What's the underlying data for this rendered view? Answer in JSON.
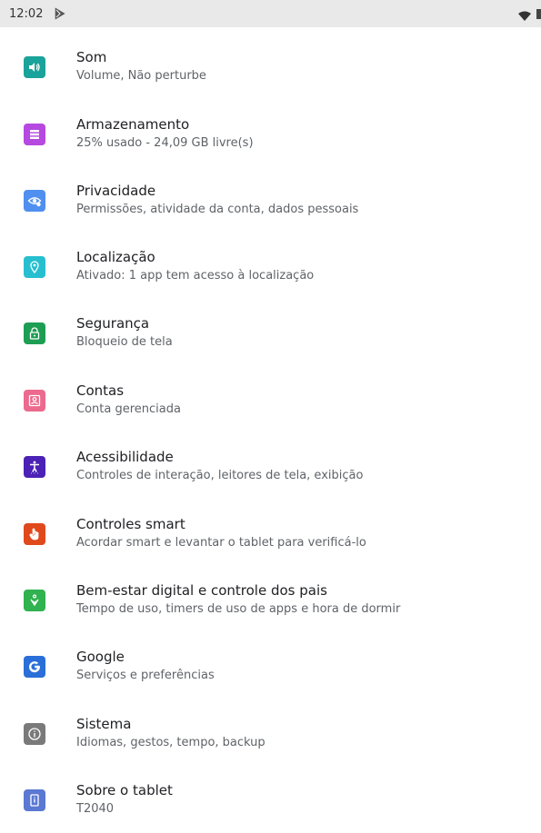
{
  "status_bar": {
    "time": "12:02",
    "notification_icon": "play-store-icon",
    "wifi_icon": "wifi-icon",
    "battery_icon": "battery-icon"
  },
  "settings": {
    "items": [
      {
        "title": "Som",
        "subtitle": "Volume, Não perturbe",
        "icon": "volume-icon",
        "color": "#1aa39a"
      },
      {
        "title": "Armazenamento",
        "subtitle": "25% usado - 24,09 GB livre(s)",
        "icon": "storage-icon",
        "color": "#b549e0"
      },
      {
        "title": "Privacidade",
        "subtitle": "Permissões, atividade da conta, dados pessoais",
        "icon": "privacy-eye-icon",
        "color": "#4f8ff0"
      },
      {
        "title": "Localização",
        "subtitle": "Ativado: 1 app tem acesso à localização",
        "icon": "location-pin-icon",
        "color": "#27bfcf"
      },
      {
        "title": "Segurança",
        "subtitle": "Bloqueio de tela",
        "icon": "lock-icon",
        "color": "#1e9e54"
      },
      {
        "title": "Contas",
        "subtitle": "Conta gerenciada",
        "icon": "account-box-icon",
        "color": "#ec6a8d"
      },
      {
        "title": "Acessibilidade",
        "subtitle": "Controles de interação, leitores de tela, exibição",
        "icon": "accessibility-icon",
        "color": "#4b22b5"
      },
      {
        "title": "Controles smart",
        "subtitle": "Acordar smart e levantar o tablet para verificá-lo",
        "icon": "hand-gesture-icon",
        "color": "#e0491c"
      },
      {
        "title": "Bem-estar digital e controle dos pais",
        "subtitle": "Tempo de uso, timers de uso de apps e hora de dormir",
        "icon": "wellbeing-icon",
        "color": "#2fb24f"
      },
      {
        "title": "Google",
        "subtitle": "Serviços e preferências",
        "icon": "google-g-icon",
        "color": "#2a6fd8"
      },
      {
        "title": "Sistema",
        "subtitle": "Idiomas, gestos, tempo, backup",
        "icon": "info-icon",
        "color": "#7a7a7a"
      },
      {
        "title": "Sobre o tablet",
        "subtitle": "T2040",
        "icon": "tablet-icon",
        "color": "#5b78d2"
      }
    ]
  }
}
